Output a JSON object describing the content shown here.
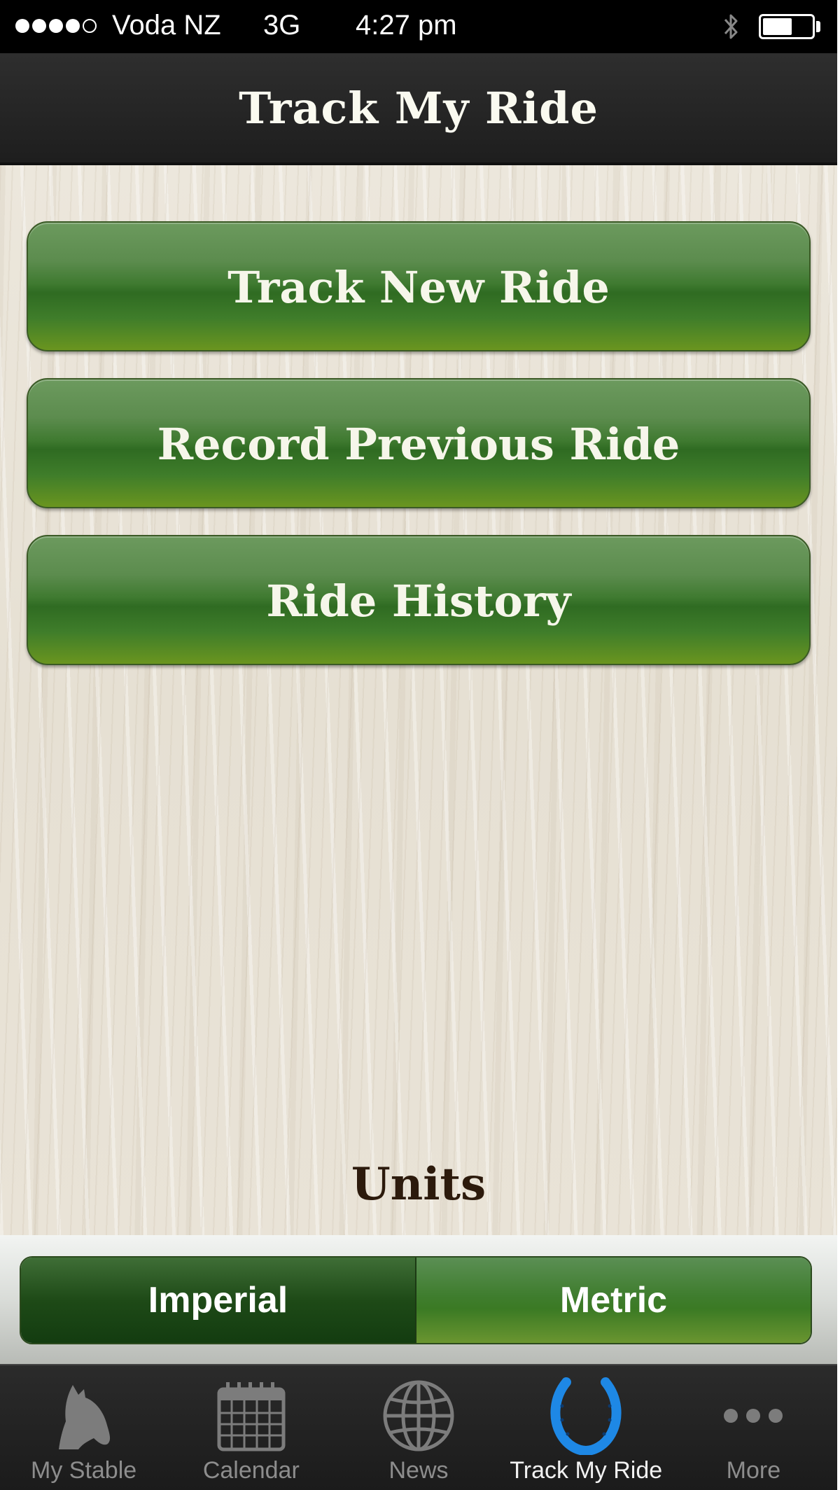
{
  "status_bar": {
    "carrier": "Voda NZ",
    "network": "3G",
    "time": "4:27 pm",
    "battery_level": 0.6,
    "signal_bars_filled": 4,
    "signal_bars_total": 5
  },
  "nav": {
    "title": "Track My Ride"
  },
  "actions": {
    "track_new": "Track New Ride",
    "record_previous": "Record Previous Ride",
    "history": "Ride History"
  },
  "units": {
    "label": "Units",
    "options": [
      "Imperial",
      "Metric"
    ],
    "selected": "Imperial"
  },
  "tabs": [
    {
      "label": "My Stable",
      "icon": "horse-head-icon",
      "active": false
    },
    {
      "label": "Calendar",
      "icon": "calendar-icon",
      "active": false
    },
    {
      "label": "News",
      "icon": "globe-icon",
      "active": false
    },
    {
      "label": "Track My Ride",
      "icon": "horseshoe-icon",
      "active": true
    },
    {
      "label": "More",
      "icon": "more-dots-icon",
      "active": false
    }
  ],
  "colors": {
    "button_green": "#3f7a30",
    "segment_selected": "#1e4a17",
    "tab_active": "#1e88e5",
    "units_text": "#2c1a0c"
  }
}
